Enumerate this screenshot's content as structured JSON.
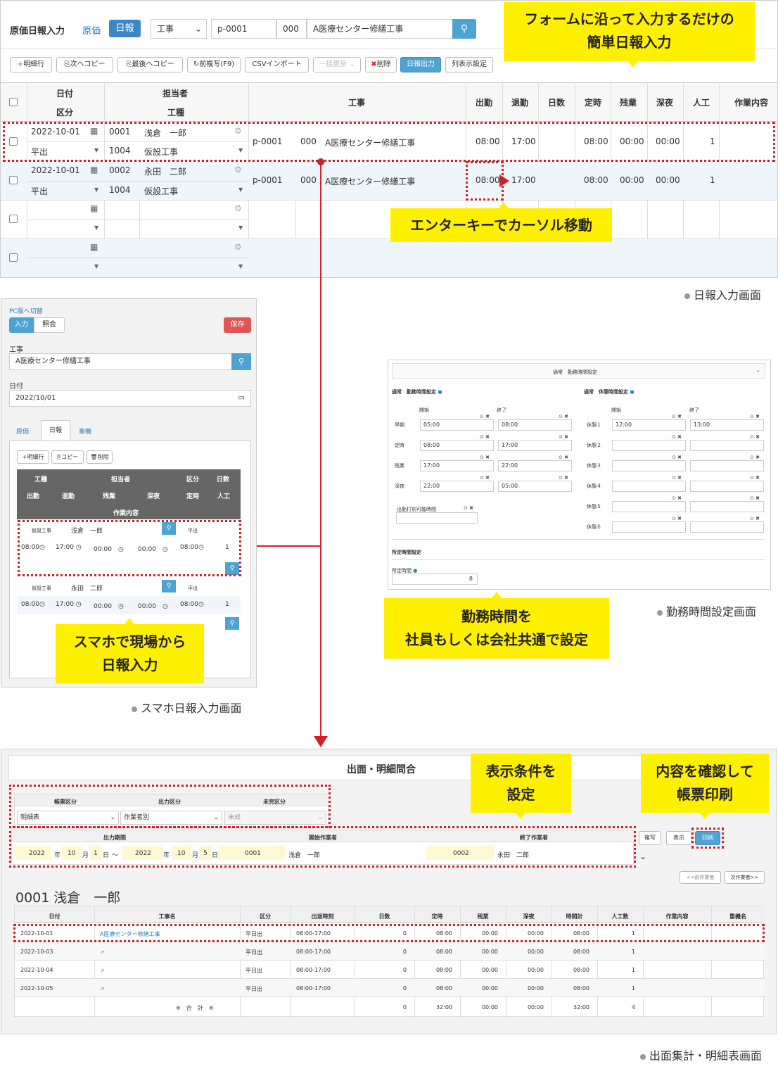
{
  "top": {
    "title": "原価日報入力",
    "tab_genka": "原価",
    "tab_nippo": "日報",
    "kouji_select": "工事",
    "kouji_code": "p-0001",
    "kouji_sub": "000",
    "kouji_name": "A医療センター修繕工事"
  },
  "toolbar": {
    "add": "明細行",
    "copy_next": "次へコピー",
    "copy_last": "最後へコピー",
    "prev_copy": "前複写(F9)",
    "csv": "CSVインポート",
    "bulk": "一括更新",
    "delete": "削除",
    "output": "日報出力",
    "columns": "列表示設定"
  },
  "grid": {
    "headers": {
      "date": "日付",
      "kubun": "区分",
      "tanto": "担当者",
      "koshu": "工種",
      "kouji": "工事",
      "shukkin": "出勤",
      "taikin": "退勤",
      "nissu": "日数",
      "teiji": "定時",
      "zangyo": "残業",
      "shinya": "深夜",
      "ninku": "人工",
      "naiyo": "作業内容"
    },
    "rows": [
      {
        "date": "2022-10-01",
        "kubun": "平出",
        "code": "0001",
        "name": "浅倉　一郎",
        "kcode": "1004",
        "koshu": "仮設工事",
        "kouji_code": "p-0001",
        "kouji_sub": "000",
        "kouji_name": "A医療センター修繕工事",
        "in": "08:00",
        "out": "17:00",
        "teiji": "08:00",
        "zangyo": "00:00",
        "shinya": "00:00",
        "ninku": "1"
      },
      {
        "date": "2022-10-01",
        "kubun": "平出",
        "code": "0002",
        "name": "永田　二郎",
        "kcode": "1004",
        "koshu": "仮設工事",
        "kouji_code": "p-0001",
        "kouji_sub": "000",
        "kouji_name": "A医療センター修繕工事",
        "in": "08:00",
        "out": "17:00",
        "teiji": "08:00",
        "zangyo": "00:00",
        "shinya": "00:00",
        "ninku": "1"
      }
    ]
  },
  "callouts": {
    "c1a": "フォームに沿って入力するだけの",
    "c1b": "簡単日報入力",
    "c2": "エンターキーでカーソル移動",
    "c3a": "勤務時間を",
    "c3b": "社員もしくは会社共通で設定",
    "c4a": "スマホで現場から",
    "c4b": "日報入力",
    "c5a": "表示条件を",
    "c5b": "設定",
    "c6a": "内容を確認して",
    "c6b": "帳票印刷"
  },
  "captions": {
    "nippo": "日報入力画面",
    "kinmu": "勤務時間設定画面",
    "sp": "スマホ日報入力画面",
    "shutsumen": "出面集計・明細表画面"
  },
  "mobile": {
    "pc_switch": "PC版へ切替",
    "tab_input": "入力",
    "tab_view": "照会",
    "save": "保存",
    "kouji_label": "工事",
    "kouji_value": "A医療センター修繕工事",
    "date_label": "日付",
    "date_value": "2022/10/01",
    "tabs": [
      "原価",
      "日報",
      "重機"
    ],
    "btn_add": "明細行",
    "btn_copy": "コピー",
    "btn_delete": "削除",
    "head1": [
      "工種",
      "担当者",
      "区分",
      "日数"
    ],
    "head2": [
      "出勤",
      "退勤",
      "残業",
      "深夜",
      "定時",
      "人工"
    ],
    "head3": "作業内容",
    "rows": [
      {
        "koshu": "仮設工事",
        "name": "浅倉　一郎",
        "kubun": "平出",
        "in": "08:00",
        "out": "17:00",
        "zan": "00:00",
        "shin": "00:00",
        "teiji": "08:00",
        "ninku": "1"
      },
      {
        "koshu": "仮設工事",
        "name": "永田　二郎",
        "kubun": "平出",
        "in": "08:00",
        "out": "17:00",
        "zan": "00:00",
        "shin": "00:00",
        "teiji": "08:00",
        "ninku": "1"
      }
    ]
  },
  "worktime": {
    "title": "通常　勤務時間設定",
    "sec_kinmu": "通常　勤務時間設定",
    "sec_kyukei": "通常　休憩時間設定",
    "start": "開始",
    "end": "終了",
    "kinmu_rows": [
      {
        "label": "早朝",
        "s": "05:00",
        "e": "08:00"
      },
      {
        "label": "定時",
        "s": "08:00",
        "e": "17:00"
      },
      {
        "label": "残業",
        "s": "17:00",
        "e": "22:00"
      },
      {
        "label": "深夜",
        "s": "22:00",
        "e": "05:00"
      }
    ],
    "kyukei_rows": [
      {
        "label": "休憩１",
        "s": "12:00",
        "e": "13:00"
      },
      {
        "label": "休憩２",
        "s": "",
        "e": ""
      },
      {
        "label": "休憩３",
        "s": "",
        "e": ""
      },
      {
        "label": "休憩４",
        "s": "",
        "e": ""
      },
      {
        "label": "休憩５",
        "s": "",
        "e": ""
      },
      {
        "label": "休憩６",
        "s": "",
        "e": ""
      }
    ],
    "punch": "出勤打刻可能時間",
    "shotei_title": "所定時間設定",
    "shotei_label": "所定時間",
    "shotei_value": "8"
  },
  "report": {
    "title": "出面・明細問合",
    "chohyo_label": "帳票区分",
    "chohyo": "明細表",
    "output_label": "出力区分",
    "output": "作業者別",
    "misumi_label": "未完区分",
    "misumi": "未成",
    "period_label": "出力期間",
    "start_worker_label": "開始作業者",
    "end_worker_label": "終了作業者",
    "y1": "2022",
    "m1": "10",
    "d1": "1",
    "y2": "2022",
    "m2": "10",
    "d2": "5",
    "nen": "年",
    "tsuki": "月",
    "hi": "日",
    "tilde": "〜",
    "sw_code": "0001",
    "sw_name": "浅倉　一郎",
    "ew_code": "0002",
    "ew_name": "永田　二郎",
    "btn_copy": "複写",
    "btn_show": "表示",
    "btn_print": "印刷",
    "prev_worker": "<<前作業者",
    "next_worker": "次作業者>>",
    "worker_heading": "0001 浅倉　一郎",
    "headers": [
      "日付",
      "工事名",
      "区分",
      "出退時刻",
      "日数",
      "定時",
      "残業",
      "深夜",
      "時間計",
      "人工数",
      "作業内容",
      "重機名"
    ],
    "rows": [
      [
        "2022-10-01",
        "A医療センター修繕工事",
        "平日出",
        "08:00-17:00",
        "0",
        "08:00",
        "00:00",
        "00:00",
        "08:00",
        "1"
      ],
      [
        "2022-10-03",
        "〃",
        "平日出",
        "08:00-17:00",
        "0",
        "08:00",
        "00:00",
        "00:00",
        "08:00",
        "1"
      ],
      [
        "2022-10-04",
        "〃",
        "平日出",
        "08:00-17:00",
        "0",
        "08:00",
        "00:00",
        "00:00",
        "08:00",
        "1"
      ],
      [
        "2022-10-05",
        "〃",
        "平日出",
        "08:00-17:00",
        "0",
        "08:00",
        "00:00",
        "00:00",
        "08:00",
        "1"
      ]
    ],
    "total_label": "※　合　計　※",
    "totals": [
      "0",
      "32:00",
      "00:00",
      "00:00",
      "32:00",
      "4"
    ]
  }
}
